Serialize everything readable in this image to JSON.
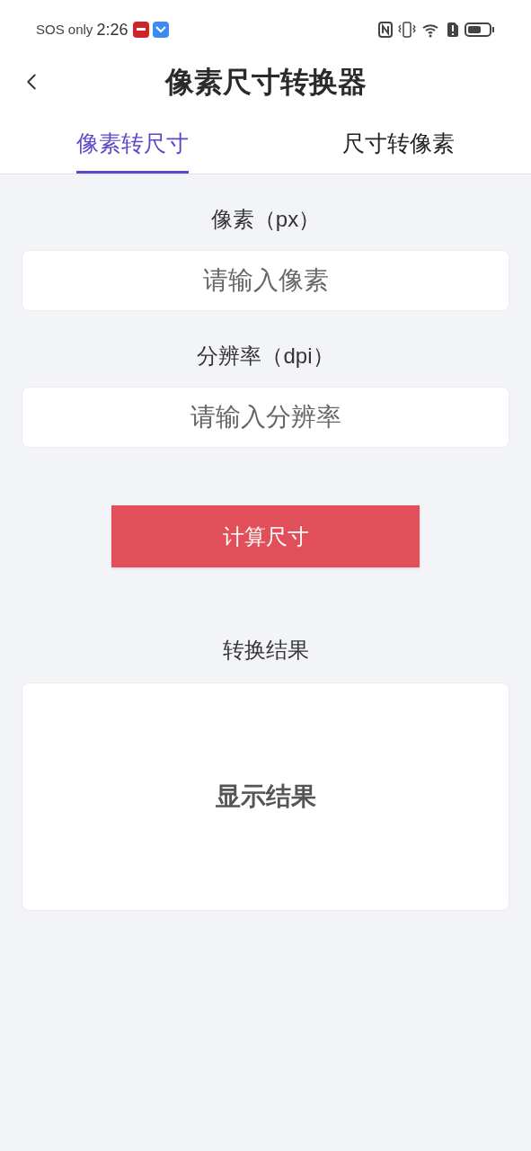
{
  "status_bar": {
    "carrier": "SOS only",
    "time": "2:26"
  },
  "header": {
    "title": "像素尺寸转换器"
  },
  "tabs": [
    {
      "label": "像素转尺寸",
      "selected": true
    },
    {
      "label": "尺寸转像素",
      "selected": false
    }
  ],
  "fields": [
    {
      "label": "像素（px）",
      "placeholder": "请输入像素"
    },
    {
      "label": "分辨率（dpi）",
      "placeholder": "请输入分辨率"
    }
  ],
  "button": "计算尺寸",
  "result": {
    "label": "转换结果",
    "value": "显示结果"
  }
}
